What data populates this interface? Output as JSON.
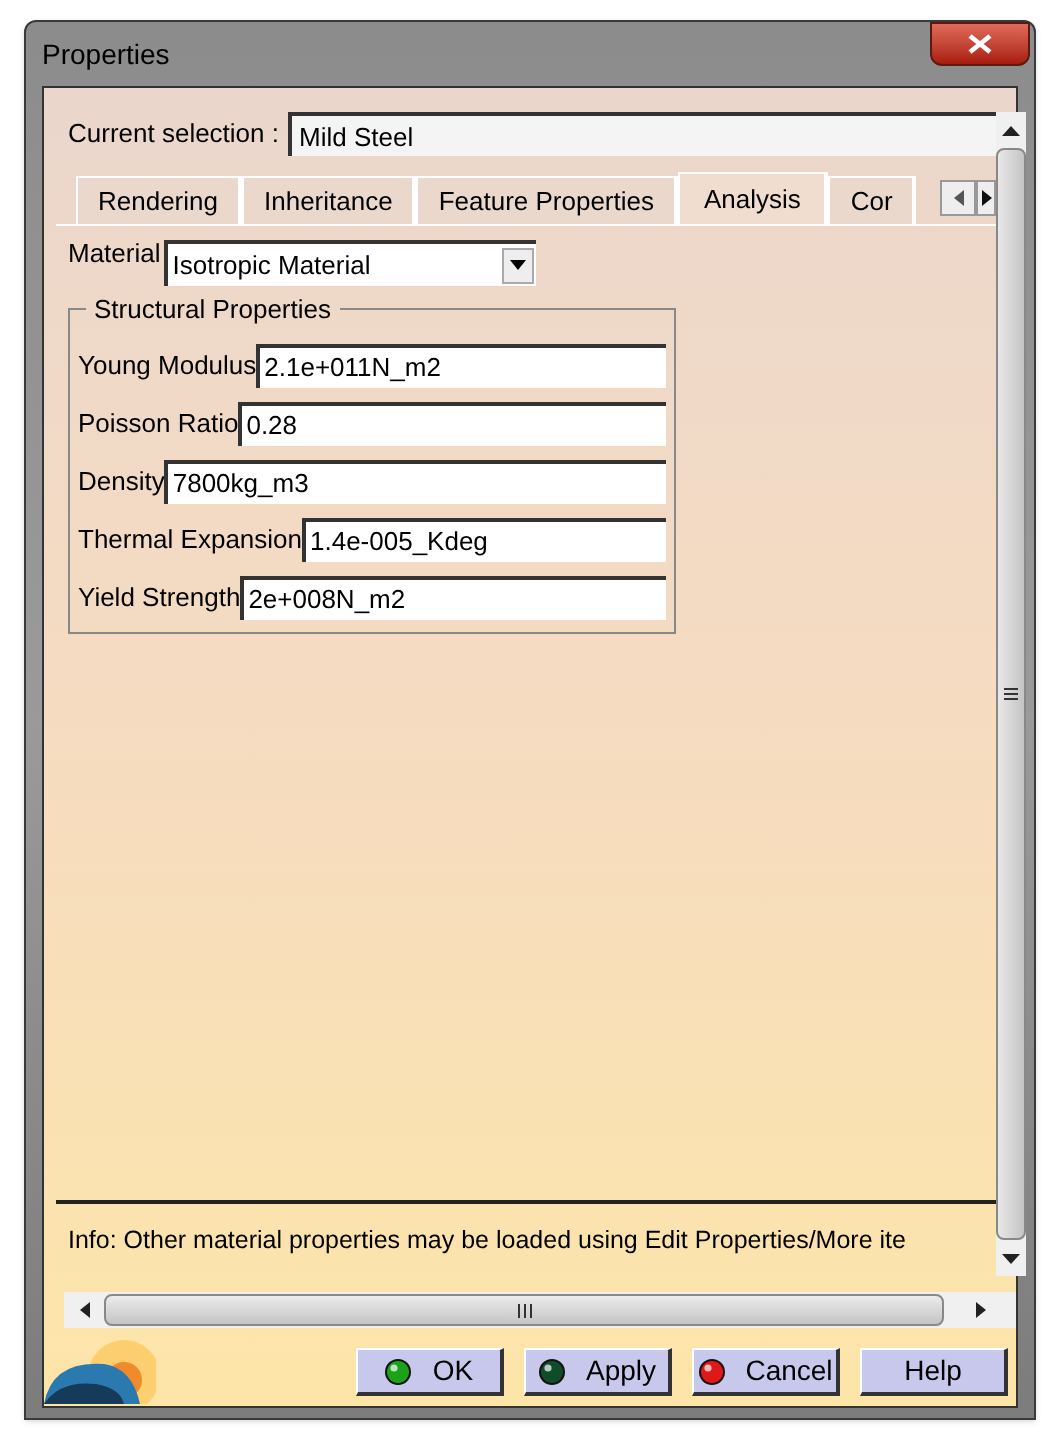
{
  "window": {
    "title": "Properties"
  },
  "current_selection": {
    "label": "Current selection :",
    "value": "Mild Steel"
  },
  "tabs": [
    {
      "label": "Rendering",
      "selected": false
    },
    {
      "label": "Inheritance",
      "selected": false
    },
    {
      "label": "Feature Properties",
      "selected": false
    },
    {
      "label": "Analysis",
      "selected": true
    },
    {
      "label": "Cor",
      "selected": false
    }
  ],
  "material": {
    "label": "Material",
    "value": "Isotropic Material"
  },
  "structural_properties": {
    "title": "Structural Properties",
    "fields": [
      {
        "label": "Young Modulus",
        "value": "2.1e+011N_m2"
      },
      {
        "label": "Poisson Ratio",
        "value": "0.28"
      },
      {
        "label": "Density",
        "value": "7800kg_m3"
      },
      {
        "label": "Thermal Expansion",
        "value": "1.4e-005_Kdeg"
      },
      {
        "label": "Yield Strength",
        "value": "2e+008N_m2"
      }
    ]
  },
  "info": "Info: Other material properties may be loaded using Edit Properties/More ite",
  "buttons": [
    {
      "label": "OK",
      "kind": "ok"
    },
    {
      "label": "Apply",
      "kind": "apply"
    },
    {
      "label": "Cancel",
      "kind": "cancel"
    },
    {
      "label": "Help",
      "kind": "help"
    }
  ]
}
